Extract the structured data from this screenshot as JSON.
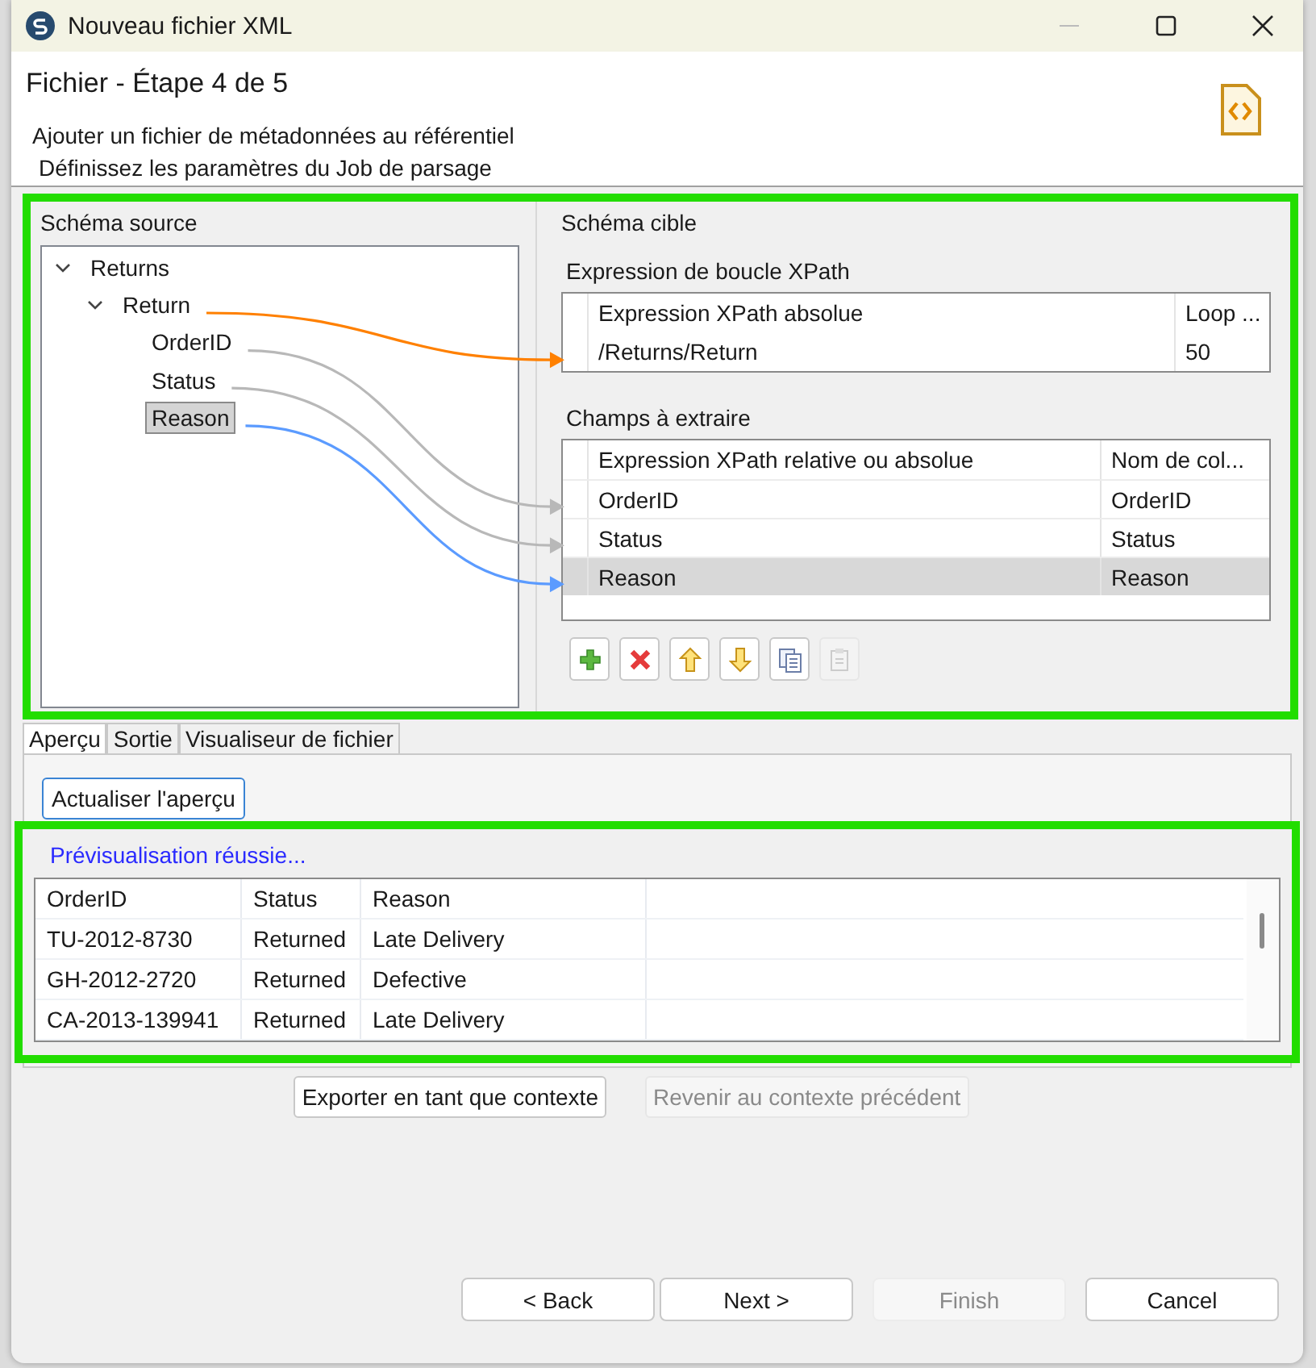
{
  "window": {
    "title": "Nouveau fichier XML"
  },
  "header": {
    "title": "Fichier - Étape 4 de 5",
    "subtitle": "Ajouter un fichier de métadonnées au référentiel",
    "description": "Définissez les paramètres du Job de parsage"
  },
  "source_schema": {
    "label": "Schéma source",
    "tree": [
      {
        "label": "Returns",
        "expanded": true,
        "selected": false,
        "children": [
          {
            "label": "Return",
            "expanded": true,
            "selected": false,
            "children": [
              {
                "label": "OrderID",
                "selected": false
              },
              {
                "label": "Status",
                "selected": false
              },
              {
                "label": "Reason",
                "selected": true
              }
            ]
          }
        ]
      }
    ]
  },
  "target_schema": {
    "label": "Schéma cible",
    "loop": {
      "label": "Expression de boucle XPath",
      "columns": [
        "Expression XPath absolue",
        "Loop ..."
      ],
      "rows": [
        {
          "cells": [
            "/Returns/Return",
            "50"
          ],
          "color": "#ff8000"
        }
      ]
    },
    "fields": {
      "label": "Champs à extraire",
      "columns": [
        "Expression XPath relative ou absolue",
        "Nom de col..."
      ],
      "rows": [
        {
          "cells": [
            "OrderID",
            "OrderID"
          ],
          "selected": false,
          "color": "#b8b8b8"
        },
        {
          "cells": [
            "Status",
            "Status"
          ],
          "selected": false,
          "color": "#b8b8b8"
        },
        {
          "cells": [
            "Reason",
            "Reason"
          ],
          "selected": true,
          "color": "#5b9bff"
        }
      ]
    },
    "toolbar": [
      {
        "kind": "add",
        "disabled": false
      },
      {
        "kind": "remove",
        "disabled": false
      },
      {
        "kind": "up",
        "disabled": false
      },
      {
        "kind": "down",
        "disabled": false
      },
      {
        "kind": "copy",
        "disabled": false
      },
      {
        "kind": "paste",
        "disabled": true
      }
    ]
  },
  "tabs": [
    {
      "label": "Aperçu",
      "selected": true
    },
    {
      "label": "Sortie",
      "selected": false
    },
    {
      "label": "Visualiseur de fichier",
      "selected": false
    }
  ],
  "preview": {
    "refresh_button": "Actualiser l'aperçu",
    "status": "Prévisualisation réussie...",
    "columns": [
      "OrderID",
      "Status",
      "Reason"
    ],
    "rows": [
      [
        "TU-2012-8730",
        "Returned",
        "Late Delivery"
      ],
      [
        "GH-2012-2720",
        "Returned",
        "Defective"
      ],
      [
        "CA-2013-139941",
        "Returned",
        "Late Delivery"
      ]
    ]
  },
  "context_buttons": [
    {
      "label": "Exporter en tant que contexte",
      "disabled": false
    },
    {
      "label": "Revenir au contexte précédent",
      "disabled": true
    }
  ],
  "buttons": [
    {
      "label": "< Back",
      "disabled": false
    },
    {
      "label": "Next >",
      "disabled": false
    },
    {
      "label": "Finish",
      "disabled": true
    },
    {
      "label": "Cancel",
      "disabled": false
    }
  ]
}
